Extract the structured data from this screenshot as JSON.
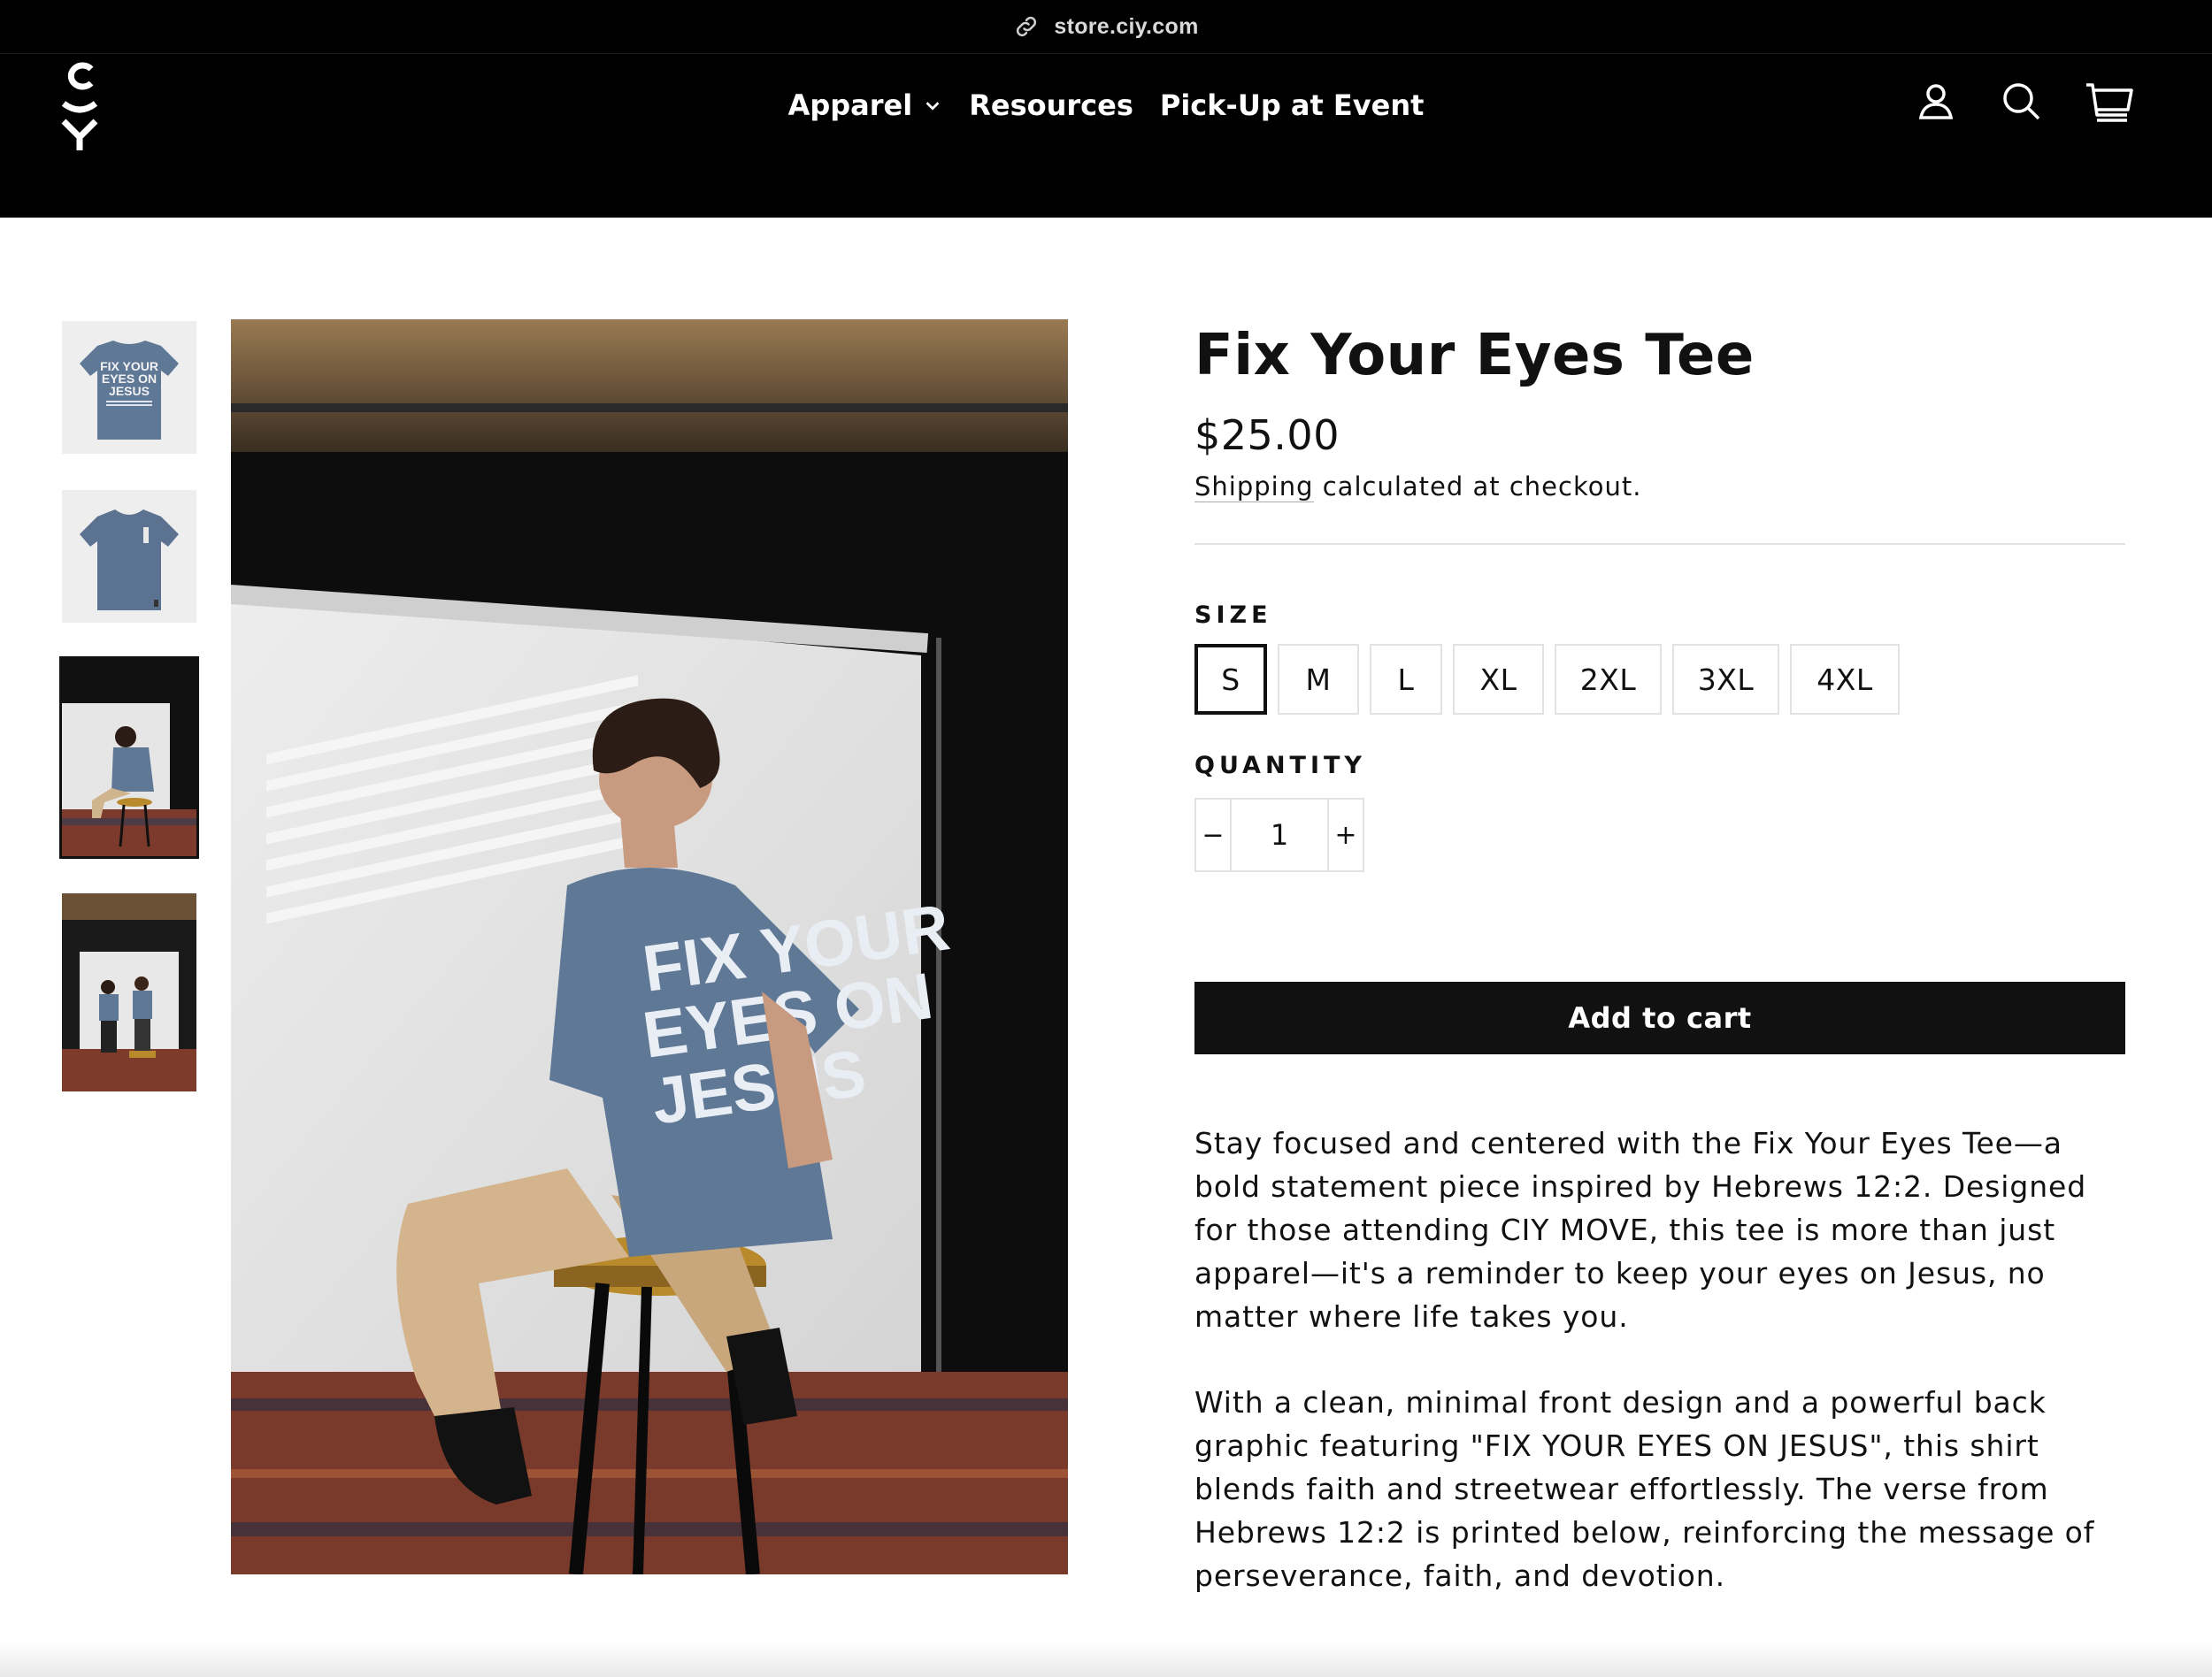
{
  "browser": {
    "url": "store.ciy.com",
    "icons": [
      "link-icon"
    ]
  },
  "header": {
    "logo": "ciy-logo",
    "nav": [
      {
        "label": "Apparel",
        "has_dropdown": true
      },
      {
        "label": "Resources"
      },
      {
        "label": "Pick-Up at Event"
      }
    ],
    "icons": [
      "account-icon",
      "search-icon",
      "cart-icon"
    ]
  },
  "gallery": {
    "thumbnails": [
      "tee-back-flat-thumbnail",
      "tee-front-flat-thumbnail",
      "model-seated-thumbnail",
      "two-models-thumbnail"
    ],
    "selected_index": 2,
    "shirt_graphic": {
      "line1": "FIX YOUR",
      "line2": "EYES ON",
      "line3": "JESUS"
    }
  },
  "product": {
    "title": "Fix Your Eyes Tee",
    "price": "$25.00",
    "shipping_link": "Shipping",
    "shipping_rest": " calculated at checkout.",
    "size_label": "SIZE",
    "sizes": [
      "S",
      "M",
      "L",
      "XL",
      "2XL",
      "3XL",
      "4XL"
    ],
    "selected_size": "S",
    "quantity_label": "QUANTITY",
    "quantity": "1",
    "minus": "−",
    "plus": "+",
    "add_to_cart": "Add to cart",
    "description": [
      "Stay focused and centered with the Fix Your Eyes Tee—a bold statement piece inspired by Hebrews 12:2. Designed for those attending CIY MOVE, this tee is more than just apparel—it's a reminder to keep your eyes on Jesus, no matter where life takes you.",
      "With a clean, minimal front design and a powerful back graphic featuring \"FIX YOUR EYES ON JESUS\", this shirt blends faith and streetwear effortlessly. The verse from Hebrews 12:2 is printed below, reinforcing the message of perseverance, faith, and devotion."
    ]
  },
  "colors": {
    "header_bg": "#000000",
    "button_bg": "#111111",
    "shirt_blue": "#5f7896",
    "border": "#e2e2e2"
  }
}
